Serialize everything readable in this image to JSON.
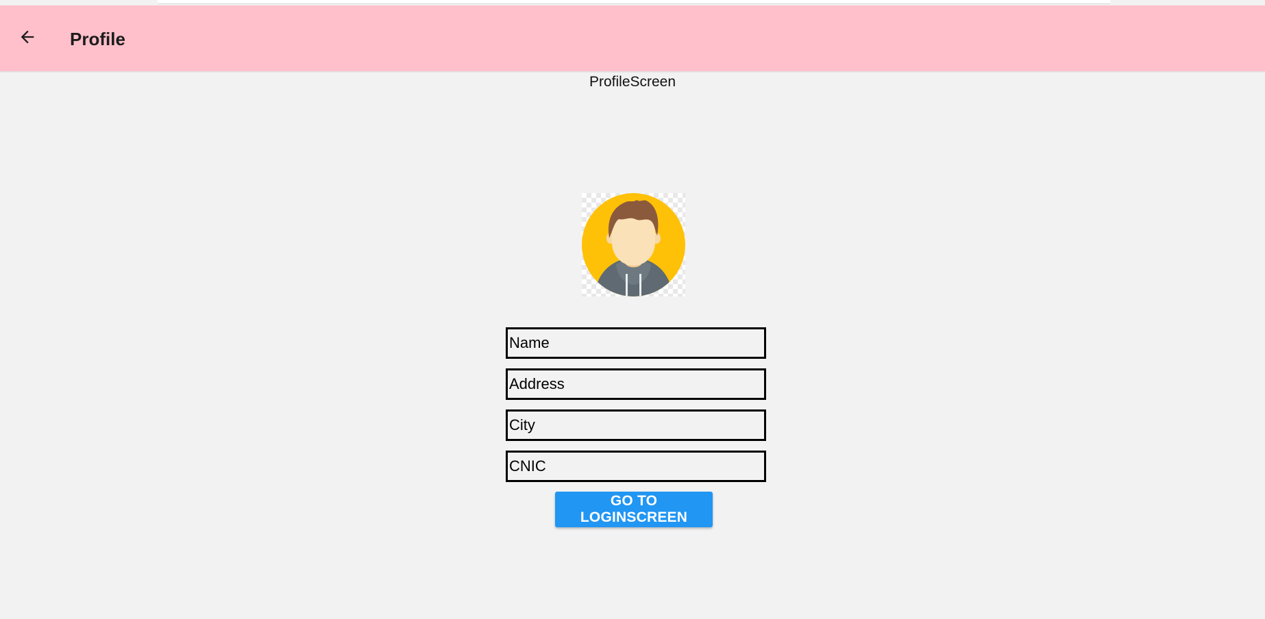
{
  "app_bar": {
    "title": "Profile",
    "back_icon": "arrow-left-icon",
    "background_color": "#ffc0cb"
  },
  "screen_label": "ProfileScreen",
  "avatar": {
    "icon": "user-avatar-icon",
    "circle_color": "#ffc107"
  },
  "form": {
    "name_placeholder": "Name",
    "address_placeholder": "Address",
    "city_placeholder": "City",
    "cnic_placeholder": "CNIC"
  },
  "button": {
    "label": "GO TO LOGINSCREEN",
    "color": "#2196f3"
  }
}
